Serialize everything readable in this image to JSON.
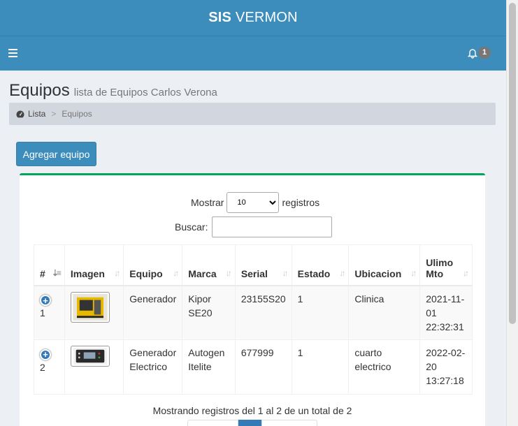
{
  "header": {
    "logo_bold": "SIS",
    "logo_rest": "VERMON",
    "notification_count": "1"
  },
  "page": {
    "title": "Equipos",
    "subtitle": "lista de Equipos Carlos Verona"
  },
  "breadcrumb": {
    "home": "Lista",
    "separator": ">",
    "current": "Equipos"
  },
  "actions": {
    "add_label": "Agregar equipo"
  },
  "table_controls": {
    "show_label": "Mostrar",
    "show_value": "10",
    "records_label": "registros",
    "search_label": "Buscar:"
  },
  "table": {
    "columns": [
      "#",
      "Imagen",
      "Equipo",
      "Marca",
      "Serial",
      "Estado",
      "Ubicacion",
      "Ulimo Mto"
    ],
    "rows": [
      {
        "num": "1",
        "equipo": "Generador",
        "marca": "Kipor SE20",
        "serial": "23155S20",
        "estado": "1",
        "ubicacion": "Clinica",
        "ultimo": "2021-11-01 22:32:31"
      },
      {
        "num": "2",
        "equipo": "Generador Electrico",
        "marca": "Autogen Itelite",
        "serial": "677999",
        "estado": "1",
        "ubicacion": "cuarto electrico",
        "ultimo": "2022-02-20 13:27:18"
      }
    ]
  },
  "footer": {
    "info": "Mostrando registros del 1 al 2 de un total de 2"
  },
  "colors": {
    "primary": "#3c8dbc",
    "box_border": "#00a65a",
    "page_bg": "#ecf0f5"
  }
}
